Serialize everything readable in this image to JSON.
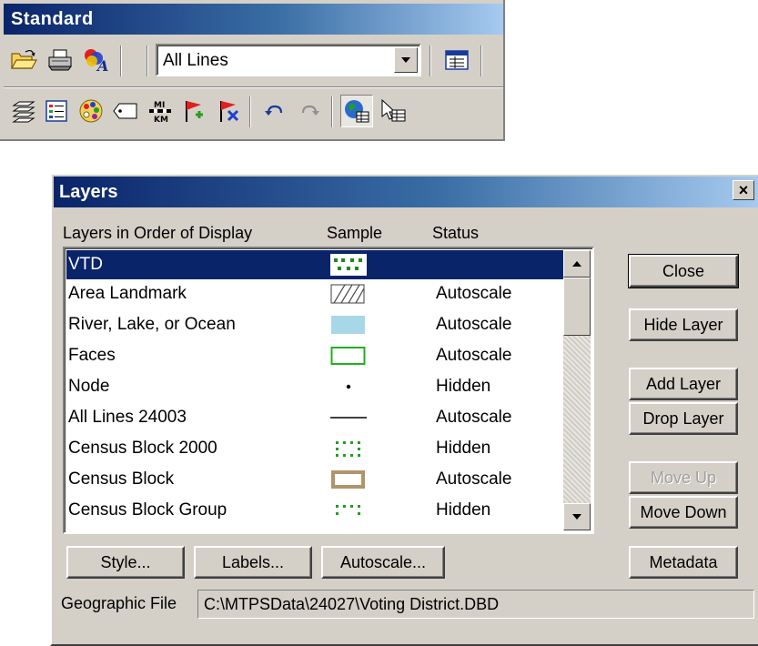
{
  "toolbar": {
    "title": "Standard",
    "layer_dropdown": {
      "selected": "All Lines"
    },
    "row1_icons": [
      "open-folder-icon",
      "print-icon",
      "style-font-icon"
    ],
    "row1_right_icons": [
      "data-view-icon"
    ],
    "row2_icons": [
      "layers-icon",
      "legend-icon",
      "palette-icon",
      "label-icon",
      "units-mi-km-icon",
      "add-flag-icon",
      "remove-flag-icon",
      "undo-icon",
      "redo-icon",
      "map-layer-icon",
      "select-icon"
    ],
    "units_top": "MI",
    "units_bottom": "KM"
  },
  "dialog": {
    "title": "Layers",
    "close_glyph": "×",
    "columns": {
      "name": "Layers in Order of Display",
      "sample": "Sample",
      "status": "Status"
    },
    "layers": [
      {
        "name": "VTD",
        "sample": "green-dots",
        "status": "",
        "selected": true
      },
      {
        "name": "Area Landmark",
        "sample": "hatch",
        "status": "Autoscale"
      },
      {
        "name": "River, Lake, or Ocean",
        "sample": "blue-fill",
        "status": "Autoscale"
      },
      {
        "name": "Faces",
        "sample": "green-outline",
        "status": "Autoscale"
      },
      {
        "name": "Node",
        "sample": "dot",
        "status": "Hidden"
      },
      {
        "name": "All Lines 24003",
        "sample": "line",
        "status": "Autoscale"
      },
      {
        "name": "Census Block 2000",
        "sample": "green-dotted",
        "status": "Hidden"
      },
      {
        "name": "Census Block",
        "sample": "tan-outline",
        "status": "Autoscale"
      },
      {
        "name": "Census Block Group",
        "sample": "green-dotted",
        "status": "Hidden"
      }
    ],
    "buttons": {
      "close": "Close",
      "hide_layer": "Hide Layer",
      "add_layer": "Add Layer",
      "drop_layer": "Drop Layer",
      "move_up": "Move Up",
      "move_down": "Move Down",
      "metadata": "Metadata",
      "style": "Style...",
      "labels": "Labels...",
      "autoscale": "Autoscale..."
    },
    "geographic_file": {
      "label": "Geographic File",
      "value": "C:\\MTPSData\\24027\\Voting District.DBD"
    }
  },
  "colors": {
    "title_bar": "#0a246a",
    "selection": "#0a246a",
    "face": "#d4d0c8",
    "sample_green": "#1a8a1a",
    "sample_blue": "#a8d8e8",
    "sample_tan": "#b09468"
  }
}
